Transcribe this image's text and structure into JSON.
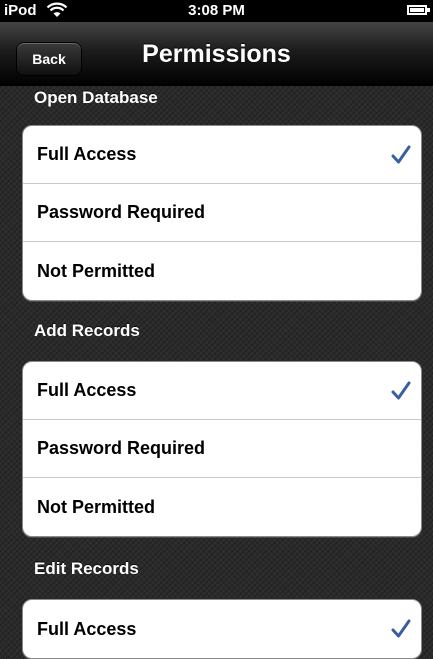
{
  "status_bar": {
    "device": "iPod",
    "time": "3:08 PM",
    "wifi_icon": "wifi-icon",
    "battery_icon": "battery-icon"
  },
  "nav": {
    "back_label": "Back",
    "title": "Permissions"
  },
  "colors": {
    "checkmark": "#3a5f9e",
    "nav_bar": "#111111",
    "background": "#2a2a2a",
    "cell": "#ffffff"
  },
  "sections": [
    {
      "title": "Open Database",
      "options": [
        {
          "label": "Full Access",
          "checked": true
        },
        {
          "label": "Password Required",
          "checked": false
        },
        {
          "label": "Not Permitted",
          "checked": false
        }
      ]
    },
    {
      "title": "Add Records",
      "options": [
        {
          "label": "Full Access",
          "checked": true
        },
        {
          "label": "Password Required",
          "checked": false
        },
        {
          "label": "Not Permitted",
          "checked": false
        }
      ]
    },
    {
      "title": "Edit Records",
      "options": [
        {
          "label": "Full Access",
          "checked": true
        }
      ]
    }
  ]
}
